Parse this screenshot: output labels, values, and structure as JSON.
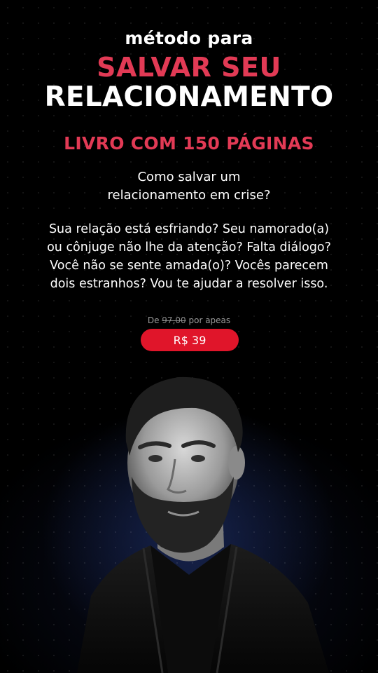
{
  "header": {
    "kicker": "método para",
    "headline_red": "SALVAR SEU",
    "headline_white": "RELACIONAMENTO"
  },
  "book_pages": "LIVRO COM 150 PÁGINAS",
  "question": {
    "line1": "Como salvar um",
    "line2": "relacionamento em crise?"
  },
  "description": {
    "line1": "Sua relação está esfriando? Seu namorado(a)",
    "line2": "ou cônjuge não lhe da atenção? Falta diálogo?",
    "line3": "Você não se sente amada(o)? Vocês parecem",
    "line4": "dois estranhos? Vou te ajudar a resolver isso."
  },
  "pricing": {
    "prefix": "De",
    "old_price": "97,00",
    "suffix": "por apeas",
    "price_label": "R$ 39"
  },
  "colors": {
    "accent_red": "#e23a55",
    "button_red": "#e0152a",
    "background": "#000000"
  }
}
